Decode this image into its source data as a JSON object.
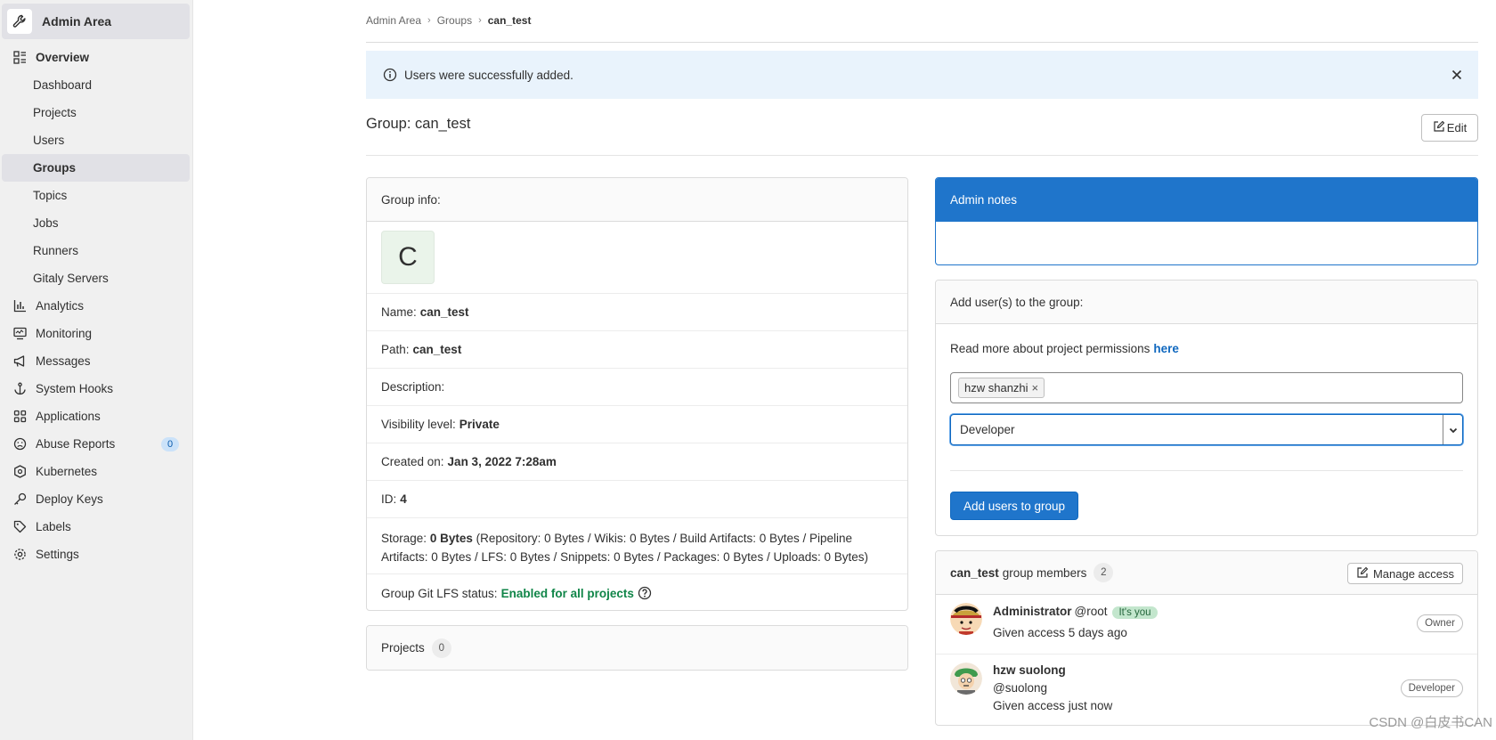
{
  "sidebar": {
    "title": "Admin Area",
    "overview": "Overview",
    "overview_items": [
      "Dashboard",
      "Projects",
      "Users",
      "Groups",
      "Topics",
      "Jobs",
      "Runners",
      "Gitaly Servers"
    ],
    "items": {
      "analytics": "Analytics",
      "monitoring": "Monitoring",
      "messages": "Messages",
      "system_hooks": "System Hooks",
      "applications": "Applications",
      "abuse_reports": "Abuse Reports",
      "abuse_count": "0",
      "kubernetes": "Kubernetes",
      "deploy_keys": "Deploy Keys",
      "labels": "Labels",
      "settings": "Settings"
    },
    "active": "Groups"
  },
  "breadcrumb": {
    "root": "Admin Area",
    "mid": "Groups",
    "current": "can_test"
  },
  "alert": {
    "message": "Users were successfully added."
  },
  "page": {
    "title": "Group: can_test",
    "edit": "Edit"
  },
  "group_info": {
    "header": "Group info:",
    "avatar_letter": "C",
    "name_label": "Name:",
    "name": "can_test",
    "path_label": "Path:",
    "path": "can_test",
    "description_label": "Description:",
    "visibility_label": "Visibility level:",
    "visibility": "Private",
    "created_label": "Created on:",
    "created": "Jan 3, 2022 7:28am",
    "id_label": "ID:",
    "id": "4",
    "storage_label": "Storage:",
    "storage_total": "0 Bytes",
    "storage_detail_1": "(Repository: 0 Bytes / Wikis: 0 Bytes / Build Artifacts: 0 Bytes / Pipeline",
    "storage_detail_2": "Artifacts: 0 Bytes / LFS: 0 Bytes / Snippets: 0 Bytes / Packages: 0 Bytes / Uploads: 0 Bytes)",
    "lfs_label": "Group Git LFS status:",
    "lfs": "Enabled for all projects"
  },
  "projects": {
    "label": "Projects",
    "count": "0"
  },
  "admin_notes": {
    "header": "Admin notes"
  },
  "add_users": {
    "header": "Add user(s) to the group:",
    "read_more": "Read more about project permissions",
    "here": "here",
    "token": "hzw shanzhi",
    "role": "Developer",
    "button": "Add users to group"
  },
  "members": {
    "group": "can_test",
    "label": "group members",
    "count": "2",
    "manage": "Manage access",
    "list": [
      {
        "name": "Administrator",
        "username": "@root",
        "badge": "It's you",
        "access": "Given access 5 days ago",
        "role": "Owner"
      },
      {
        "name": "hzw suolong",
        "username": "@suolong",
        "access": "Given access just now",
        "role": "Developer"
      }
    ]
  },
  "watermark": "CSDN @白皮书CAN"
}
